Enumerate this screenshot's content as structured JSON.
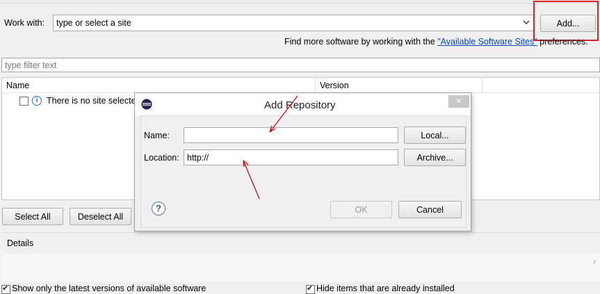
{
  "work_with": {
    "label": "Work with:",
    "combo_value": "type or select a site",
    "add_button": "Add...",
    "hint_prefix": "Find more software by working with the ",
    "hint_link": "\"Available Software Sites\"",
    "hint_suffix": " preferences."
  },
  "filter": {
    "placeholder": "type filter text"
  },
  "table": {
    "columns": [
      "Name",
      "Version"
    ],
    "rows": [
      {
        "label": "There is no site selected."
      }
    ]
  },
  "selection_buttons": {
    "select_all": "Select All",
    "deselect_all": "Deselect All"
  },
  "details": {
    "label": "Details"
  },
  "options": {
    "show_latest": "Show only the latest versions of available software",
    "hide_installed": "Hide items that are already installed"
  },
  "dialog": {
    "title": "Add Repository",
    "close_glyph": "✕",
    "name_label": "Name:",
    "name_value": "",
    "local_button": "Local...",
    "location_label": "Location:",
    "location_value": "http://",
    "archive_button": "Archive...",
    "help_glyph": "?",
    "ok_button": "OK",
    "cancel_button": "Cancel"
  },
  "annotations": {
    "highlight_color": "#e02020",
    "arrow_color": "#c00000"
  }
}
